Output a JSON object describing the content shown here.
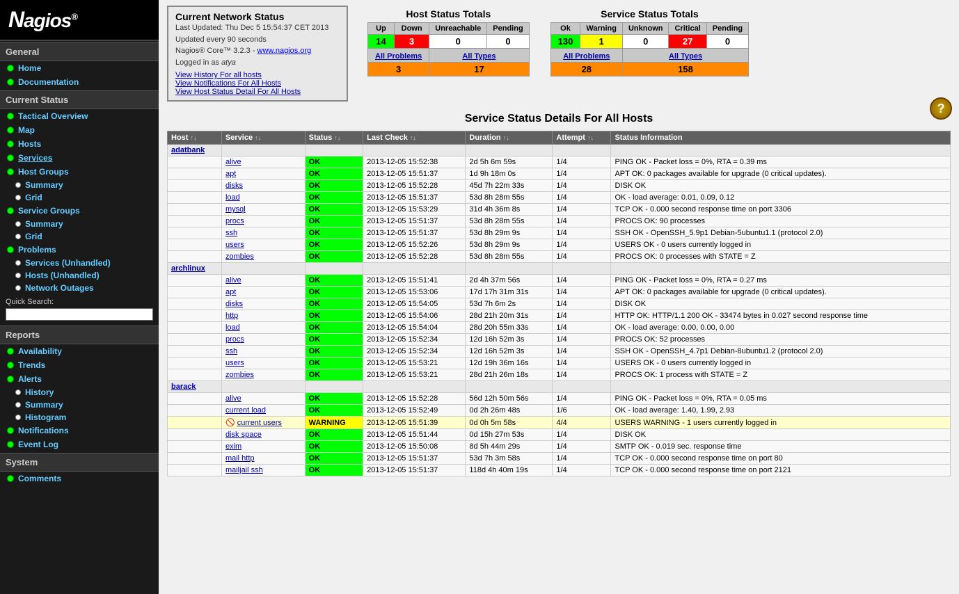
{
  "sidebar": {
    "logo": "Nagios",
    "sections": [
      {
        "title": "General",
        "items": [
          {
            "label": "Home",
            "dot": "green",
            "sub": false
          },
          {
            "label": "Documentation",
            "dot": "green",
            "sub": false
          }
        ]
      },
      {
        "title": "Current Status",
        "items": [
          {
            "label": "Tactical Overview",
            "dot": "green",
            "sub": false
          },
          {
            "label": "Map",
            "dot": "green",
            "sub": false
          },
          {
            "label": "Hosts",
            "dot": "green",
            "sub": false
          },
          {
            "label": "Services",
            "dot": "green",
            "sub": false
          },
          {
            "label": "Host Groups",
            "dot": "green",
            "sub": false
          },
          {
            "label": "Summary",
            "dot": "white",
            "sub": true
          },
          {
            "label": "Grid",
            "dot": "white",
            "sub": true
          },
          {
            "label": "Service Groups",
            "dot": "green",
            "sub": false
          },
          {
            "label": "Summary",
            "dot": "white",
            "sub": true
          },
          {
            "label": "Grid",
            "dot": "white",
            "sub": true
          },
          {
            "label": "Problems",
            "dot": "green",
            "sub": false
          },
          {
            "label": "Services (Unhandled)",
            "dot": "white",
            "sub": true
          },
          {
            "label": "Hosts (Unhandled)",
            "dot": "white",
            "sub": true
          },
          {
            "label": "Network Outages",
            "dot": "white",
            "sub": true
          }
        ]
      },
      {
        "title": "quick_search",
        "items": []
      },
      {
        "title": "Reports",
        "items": [
          {
            "label": "Availability",
            "dot": "green",
            "sub": false
          },
          {
            "label": "Trends",
            "dot": "green",
            "sub": false
          },
          {
            "label": "Alerts",
            "dot": "green",
            "sub": false
          },
          {
            "label": "History",
            "dot": "white",
            "sub": true
          },
          {
            "label": "Summary",
            "dot": "white",
            "sub": true
          },
          {
            "label": "Histogram",
            "dot": "white",
            "sub": true
          },
          {
            "label": "Notifications",
            "dot": "green",
            "sub": false
          },
          {
            "label": "Event Log",
            "dot": "green",
            "sub": false
          }
        ]
      },
      {
        "title": "System",
        "items": [
          {
            "label": "Comments",
            "dot": "green",
            "sub": false
          }
        ]
      }
    ]
  },
  "network_status": {
    "title": "Current Network Status",
    "last_updated": "Last Updated: Thu Dec 5 15:54:37 CET 2013",
    "update_interval": "Updated every 90 seconds",
    "version": "Nagios® Core™ 3.2.3 - ",
    "version_link": "www.nagios.org",
    "logged_in": "Logged in as atya",
    "links": [
      "View History For all hosts",
      "View Notifications For All Hosts",
      "View Host Status Detail For All Hosts"
    ]
  },
  "host_status_totals": {
    "title": "Host Status Totals",
    "headers": [
      "Up",
      "Down",
      "Unreachable",
      "Pending"
    ],
    "values": [
      "14",
      "3",
      "0",
      "0"
    ],
    "value_classes": [
      "td-green",
      "td-red",
      "td-white",
      "td-white"
    ],
    "row2_headers": [
      "All Problems",
      "All Types"
    ],
    "row2_values": [
      "3",
      "17"
    ],
    "row2_classes": [
      "td-orange",
      "td-orange"
    ]
  },
  "service_status_totals": {
    "title": "Service Status Totals",
    "headers": [
      "Ok",
      "Warning",
      "Unknown",
      "Critical",
      "Pending"
    ],
    "values": [
      "130",
      "1",
      "0",
      "27",
      "0"
    ],
    "value_classes": [
      "td-green",
      "td-yellow",
      "td-white",
      "td-red",
      "td-white"
    ],
    "row2_headers": [
      "All Problems",
      "All Types"
    ],
    "row2_values": [
      "28",
      "158"
    ],
    "row2_classes": [
      "td-orange",
      "td-orange"
    ]
  },
  "service_details": {
    "title": "Service Status Details For All Hosts",
    "col_headers": [
      "Host",
      "Service",
      "Status",
      "Last Check",
      "Duration",
      "Attempt",
      "Status Information"
    ],
    "rows": [
      {
        "type": "host",
        "host": "adatbank",
        "service": "",
        "status": "",
        "last_check": "",
        "duration": "",
        "attempt": "",
        "info": ""
      },
      {
        "type": "service",
        "host": "",
        "service": "alive",
        "status": "OK",
        "last_check": "2013-12-05 15:52:38",
        "duration": "2d 5h 6m 59s",
        "attempt": "1/4",
        "info": "PING OK - Packet loss = 0%, RTA = 0.39 ms"
      },
      {
        "type": "service",
        "host": "",
        "service": "apt",
        "status": "OK",
        "last_check": "2013-12-05 15:51:37",
        "duration": "1d 9h 18m 0s",
        "attempt": "1/4",
        "info": "APT OK: 0 packages available for upgrade (0 critical updates)."
      },
      {
        "type": "service",
        "host": "",
        "service": "disks",
        "status": "OK",
        "last_check": "2013-12-05 15:52:28",
        "duration": "45d 7h 22m 33s",
        "attempt": "1/4",
        "info": "DISK OK"
      },
      {
        "type": "service",
        "host": "",
        "service": "load",
        "status": "OK",
        "last_check": "2013-12-05 15:51:37",
        "duration": "53d 8h 28m 55s",
        "attempt": "1/4",
        "info": "OK - load average: 0.01, 0.09, 0.12"
      },
      {
        "type": "service",
        "host": "",
        "service": "mysql",
        "status": "OK",
        "last_check": "2013-12-05 15:53:29",
        "duration": "31d 4h 36m 8s",
        "attempt": "1/4",
        "info": "TCP OK - 0.000 second response time on port 3306"
      },
      {
        "type": "service",
        "host": "",
        "service": "procs",
        "status": "OK",
        "last_check": "2013-12-05 15:51:37",
        "duration": "53d 8h 28m 55s",
        "attempt": "1/4",
        "info": "PROCS OK: 90 processes"
      },
      {
        "type": "service",
        "host": "",
        "service": "ssh",
        "status": "OK",
        "last_check": "2013-12-05 15:51:37",
        "duration": "53d 8h 29m 9s",
        "attempt": "1/4",
        "info": "SSH OK - OpenSSH_5.9p1 Debian-5ubuntu1.1 (protocol 2.0)"
      },
      {
        "type": "service",
        "host": "",
        "service": "users",
        "status": "OK",
        "last_check": "2013-12-05 15:52:26",
        "duration": "53d 8h 29m 9s",
        "attempt": "1/4",
        "info": "USERS OK - 0 users currently logged in"
      },
      {
        "type": "service",
        "host": "",
        "service": "zombies",
        "status": "OK",
        "last_check": "2013-12-05 15:52:28",
        "duration": "53d 8h 28m 55s",
        "attempt": "1/4",
        "info": "PROCS OK: 0 processes with STATE = Z"
      },
      {
        "type": "host",
        "host": "archlinux",
        "service": "",
        "status": "",
        "last_check": "",
        "duration": "",
        "attempt": "",
        "info": ""
      },
      {
        "type": "service",
        "host": "",
        "service": "alive",
        "status": "OK",
        "last_check": "2013-12-05 15:51:41",
        "duration": "2d 4h 37m 56s",
        "attempt": "1/4",
        "info": "PING OK - Packet loss = 0%, RTA = 0.27 ms"
      },
      {
        "type": "service",
        "host": "",
        "service": "apt",
        "status": "OK",
        "last_check": "2013-12-05 15:53:06",
        "duration": "17d 17h 31m 31s",
        "attempt": "1/4",
        "info": "APT OK: 0 packages available for upgrade (0 critical updates)."
      },
      {
        "type": "service",
        "host": "",
        "service": "disks",
        "status": "OK",
        "last_check": "2013-12-05 15:54:05",
        "duration": "53d 7h 6m 2s",
        "attempt": "1/4",
        "info": "DISK OK"
      },
      {
        "type": "service",
        "host": "",
        "service": "http",
        "status": "OK",
        "last_check": "2013-12-05 15:54:06",
        "duration": "28d 21h 20m 31s",
        "attempt": "1/4",
        "info": "HTTP OK: HTTP/1.1 200 OK - 33474 bytes in 0.027 second response time"
      },
      {
        "type": "service",
        "host": "",
        "service": "load",
        "status": "OK",
        "last_check": "2013-12-05 15:54:04",
        "duration": "28d 20h 55m 33s",
        "attempt": "1/4",
        "info": "OK - load average: 0.00, 0.00, 0.00"
      },
      {
        "type": "service",
        "host": "",
        "service": "procs",
        "status": "OK",
        "last_check": "2013-12-05 15:52:34",
        "duration": "12d 16h 52m 3s",
        "attempt": "1/4",
        "info": "PROCS OK: 52 processes"
      },
      {
        "type": "service",
        "host": "",
        "service": "ssh",
        "status": "OK",
        "last_check": "2013-12-05 15:52:34",
        "duration": "12d 16h 52m 3s",
        "attempt": "1/4",
        "info": "SSH OK - OpenSSH_4.7p1 Debian-8ubuntu1.2 (protocol 2.0)"
      },
      {
        "type": "service",
        "host": "",
        "service": "users",
        "status": "OK",
        "last_check": "2013-12-05 15:53:21",
        "duration": "12d 19h 36m 16s",
        "attempt": "1/4",
        "info": "USERS OK - 0 users currently logged in"
      },
      {
        "type": "service",
        "host": "",
        "service": "zombies",
        "status": "OK",
        "last_check": "2013-12-05 15:53:21",
        "duration": "28d 21h 26m 18s",
        "attempt": "1/4",
        "info": "PROCS OK: 1 process with STATE = Z"
      },
      {
        "type": "host",
        "host": "barack",
        "service": "",
        "status": "",
        "last_check": "",
        "duration": "",
        "attempt": "",
        "info": ""
      },
      {
        "type": "service",
        "host": "",
        "service": "alive",
        "status": "OK",
        "last_check": "2013-12-05 15:52:28",
        "duration": "56d 12h 50m 56s",
        "attempt": "1/4",
        "info": "PING OK - Packet loss = 0%, RTA = 0.05 ms"
      },
      {
        "type": "service",
        "host": "",
        "service": "current load",
        "status": "OK",
        "last_check": "2013-12-05 15:52:49",
        "duration": "0d 2h 26m 48s",
        "attempt": "1/6",
        "info": "OK - load average: 1.40, 1.99, 2.93"
      },
      {
        "type": "warning",
        "host": "",
        "service": "current users",
        "status": "WARNING",
        "last_check": "2013-12-05 15:51:39",
        "duration": "0d 0h 5m 58s",
        "attempt": "4/4",
        "info": "USERS WARNING - 1 users currently logged in",
        "has_icon": true
      },
      {
        "type": "service",
        "host": "",
        "service": "disk space",
        "status": "OK",
        "last_check": "2013-12-05 15:51:44",
        "duration": "0d 15h 27m 53s",
        "attempt": "1/4",
        "info": "DISK OK"
      },
      {
        "type": "service",
        "host": "",
        "service": "exim",
        "status": "OK",
        "last_check": "2013-12-05 15:50:08",
        "duration": "8d 5h 44m 29s",
        "attempt": "1/4",
        "info": "SMTP OK - 0.019 sec. response time"
      },
      {
        "type": "service",
        "host": "",
        "service": "mail http",
        "status": "OK",
        "last_check": "2013-12-05 15:51:37",
        "duration": "53d 7h 3m 58s",
        "attempt": "1/4",
        "info": "TCP OK - 0.000 second response time on port 80"
      },
      {
        "type": "service",
        "host": "",
        "service": "mailjail ssh",
        "status": "OK",
        "last_check": "2013-12-05 15:51:37",
        "duration": "118d 4h 40m 19s",
        "attempt": "1/4",
        "info": "TCP OK - 0.000 second response time on port 2121"
      }
    ]
  },
  "quick_search": {
    "label": "Quick Search:",
    "placeholder": ""
  },
  "help_button": "?"
}
